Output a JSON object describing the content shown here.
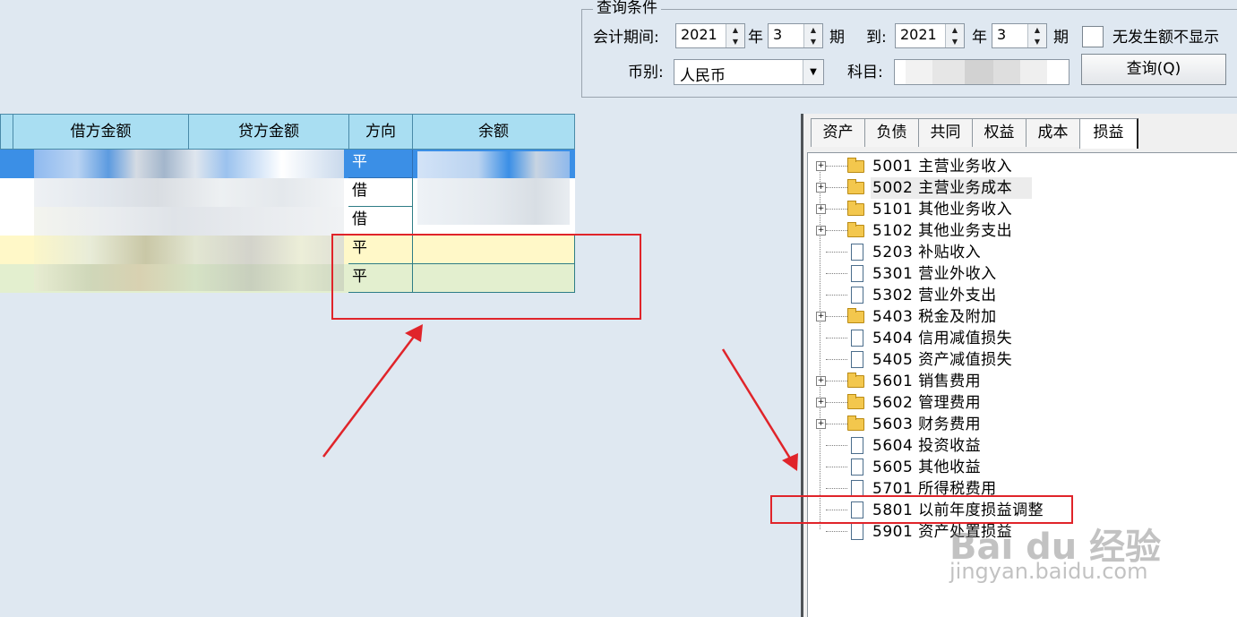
{
  "query": {
    "legend": "查询条件",
    "period_label": "会计期间:",
    "from_year": "2021",
    "year_unit": "年",
    "from_period": "3",
    "period_unit": "期",
    "to_label": "到:",
    "to_year": "2021",
    "to_period": "3",
    "no_amount_hide_label": "无发生额不显示",
    "currency_label": "币别:",
    "currency_value": "人民币",
    "subject_label": "科目:",
    "subject_value": "",
    "query_button": "查询(Q)"
  },
  "grid": {
    "columns": [
      "借方金额",
      "贷方金额",
      "方向",
      "余额"
    ],
    "rows": [
      {
        "direction": "平",
        "style": "selected"
      },
      {
        "direction": "借",
        "style": "white"
      },
      {
        "direction": "借",
        "style": "white"
      },
      {
        "direction": "平",
        "style": "yellow"
      },
      {
        "direction": "平",
        "style": "green"
      }
    ]
  },
  "panel": {
    "tabs": [
      "资产",
      "负债",
      "共同",
      "权益",
      "成本",
      "损益"
    ],
    "active_tab": "损益",
    "tree": [
      {
        "code": "5001",
        "name": "主营业务收入",
        "type": "folder",
        "expandable": true
      },
      {
        "code": "5002",
        "name": "主营业务成本",
        "type": "folder-open",
        "expandable": true
      },
      {
        "code": "5101",
        "name": "其他业务收入",
        "type": "folder",
        "expandable": true
      },
      {
        "code": "5102",
        "name": "其他业务支出",
        "type": "folder",
        "expandable": true
      },
      {
        "code": "5203",
        "name": "补贴收入",
        "type": "doc",
        "expandable": false
      },
      {
        "code": "5301",
        "name": "营业外收入",
        "type": "doc",
        "expandable": false
      },
      {
        "code": "5302",
        "name": "营业外支出",
        "type": "doc",
        "expandable": false
      },
      {
        "code": "5403",
        "name": "税金及附加",
        "type": "folder",
        "expandable": true
      },
      {
        "code": "5404",
        "name": "信用减值损失",
        "type": "doc",
        "expandable": false
      },
      {
        "code": "5405",
        "name": "资产减值损失",
        "type": "doc",
        "expandable": false
      },
      {
        "code": "5601",
        "name": "销售费用",
        "type": "folder",
        "expandable": true
      },
      {
        "code": "5602",
        "name": "管理费用",
        "type": "folder",
        "expandable": true
      },
      {
        "code": "5603",
        "name": "财务费用",
        "type": "folder",
        "expandable": true
      },
      {
        "code": "5604",
        "name": "投资收益",
        "type": "doc",
        "expandable": false
      },
      {
        "code": "5605",
        "name": "其他收益",
        "type": "doc",
        "expandable": false
      },
      {
        "code": "5701",
        "name": "所得税费用",
        "type": "doc",
        "expandable": false
      },
      {
        "code": "5801",
        "name": "以前年度损益调整",
        "type": "doc",
        "expandable": false
      },
      {
        "code": "5901",
        "name": "资产处置损益",
        "type": "doc",
        "expandable": false
      }
    ]
  },
  "watermark": {
    "line1": "Bai du 经验",
    "line2": "jingyan.baidu.com"
  },
  "colors": {
    "highlight": "#e0242a",
    "header": "#a9def2",
    "selected_row": "#3b8fe6",
    "yellow_row": "#fff8c8",
    "green_row": "#e3efcf"
  }
}
